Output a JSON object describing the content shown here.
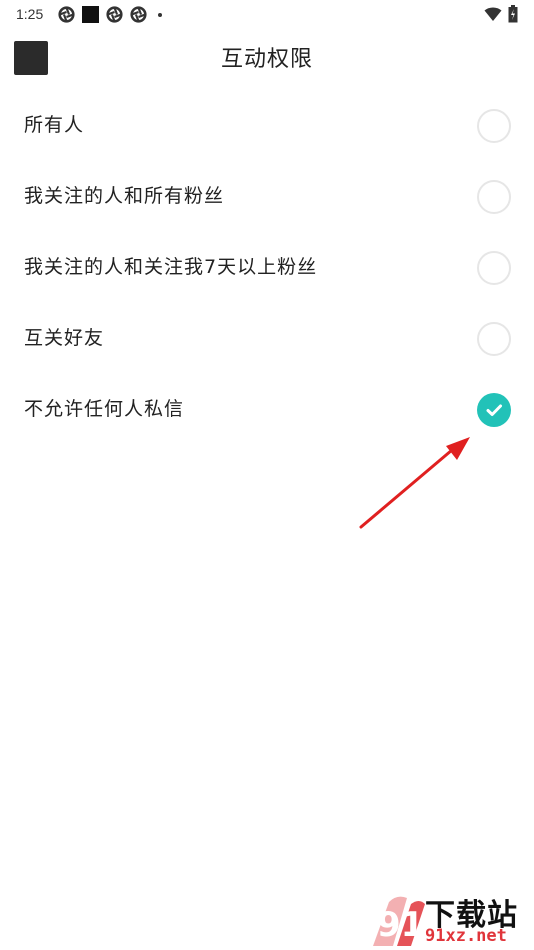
{
  "status_bar": {
    "time": "1:25",
    "left_icons": [
      "aperture-icon",
      "black-square-icon",
      "aperture-icon",
      "aperture-icon",
      "dot-icon"
    ],
    "right_icons": [
      "wifi-icon",
      "battery-icon"
    ]
  },
  "header": {
    "title": "互动权限",
    "back_icon": "back-icon"
  },
  "options": [
    {
      "label": "所有人",
      "checked": false
    },
    {
      "label": "我关注的人和所有粉丝",
      "checked": false
    },
    {
      "label": "我关注的人和关注我7天以上粉丝",
      "checked": false
    },
    {
      "label": "互关好友",
      "checked": false
    },
    {
      "label": "不允许任何人私信",
      "checked": true
    }
  ],
  "colors": {
    "accent": "#22c2b8",
    "annotation_arrow": "#e02020",
    "radio_border": "#e6e6e6"
  },
  "watermark": {
    "logo_text": "91",
    "title": "下载站",
    "url": "91xz.net"
  }
}
